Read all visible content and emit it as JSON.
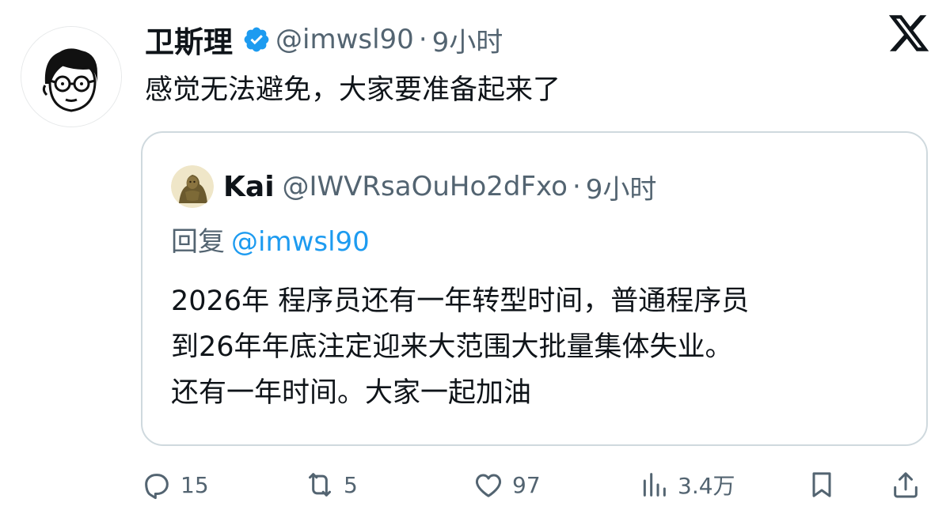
{
  "tweet": {
    "author_name": "卫斯理",
    "author_handle": "@imwsl90",
    "separator": "·",
    "time": "9小时",
    "text": "感觉无法避免，大家要准备起来了",
    "verified": true
  },
  "quote": {
    "author_name": "Kai",
    "author_handle": "@IWVRsaOuHo2dFxo",
    "separator": "·",
    "time": "9小时",
    "reply_label": "回复",
    "reply_mention": "@imwsl90",
    "lines": [
      "2026年 程序员还有一年转型时间，普通程序员",
      "到26年年底注定迎来大范围大批量集体失业。",
      "还有一年时间。大家一起加油"
    ]
  },
  "actions": {
    "replies": "15",
    "retweets": "5",
    "likes": "97",
    "views": "3.4万"
  },
  "colors": {
    "text": "#0f1419",
    "secondary": "#536471",
    "accent": "#1d9bf0",
    "border": "#cfd9de"
  },
  "icons": [
    "x-logo-icon",
    "verified-badge-icon",
    "reply-icon",
    "retweet-icon",
    "like-icon",
    "views-icon",
    "bookmark-icon",
    "share-icon"
  ]
}
